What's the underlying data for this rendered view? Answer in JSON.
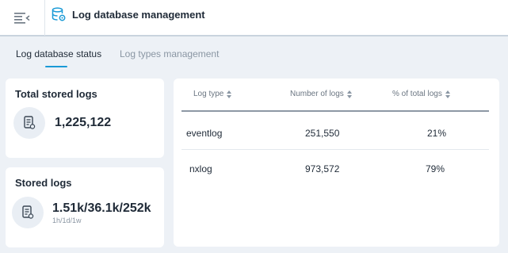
{
  "header": {
    "title": "Log database management",
    "menu_icon": "menu-collapse-icon",
    "title_icon": "database-settings-icon"
  },
  "tabs": [
    {
      "label": "Log database status",
      "active": true
    },
    {
      "label": "Log types management",
      "active": false
    }
  ],
  "total_stored": {
    "title": "Total stored logs",
    "value": "1,225,122",
    "icon": "log-document-icon"
  },
  "stored_logs": {
    "title": "Stored logs",
    "value": "1.51k/36.1k/252k",
    "caption": "1h/1d/1w",
    "icon": "log-document-icon"
  },
  "table": {
    "columns": [
      "Log type",
      "Number of logs",
      "% of total logs"
    ],
    "rows": [
      {
        "log_type": "eventlog",
        "count": "251,550",
        "percent": "21%"
      },
      {
        "log_type": "nxlog",
        "count": "973,572",
        "percent": "79%"
      }
    ]
  },
  "colors": {
    "accent": "#1a9ad6",
    "background": "#edf1f6",
    "card": "#ffffff",
    "text": "#1f2a37",
    "muted": "#8a96a3"
  }
}
